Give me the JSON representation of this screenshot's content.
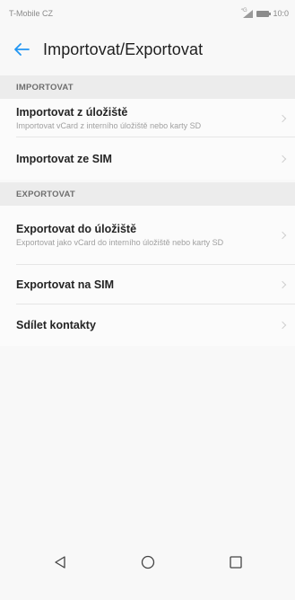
{
  "status_bar": {
    "carrier": "T-Mobile CZ",
    "network_tag": "⁴G",
    "time": "10:0"
  },
  "toolbar": {
    "title": "Importovat/Exportovat"
  },
  "sections": {
    "import": {
      "header": "IMPORTOVAT",
      "items": [
        {
          "title": "Importovat z úložiště",
          "subtitle": "Importovat vCard z interního úložiště nebo karty SD"
        },
        {
          "title": "Importovat ze SIM",
          "subtitle": ""
        }
      ]
    },
    "export": {
      "header": "EXPORTOVAT",
      "items": [
        {
          "title": "Exportovat do úložiště",
          "subtitle": "Exportovat jako vCard do interního úložiště nebo karty SD"
        },
        {
          "title": "Exportovat na SIM",
          "subtitle": ""
        },
        {
          "title": "Sdílet kontakty",
          "subtitle": ""
        }
      ]
    }
  },
  "colors": {
    "accent": "#2196f3",
    "background": "#f8f8f8",
    "section_header_bg": "#ececec"
  },
  "icons": {
    "back": "arrow-left-icon",
    "nav_back": "triangle-back-icon",
    "nav_home": "circle-home-icon",
    "nav_recent": "square-recent-icon"
  }
}
